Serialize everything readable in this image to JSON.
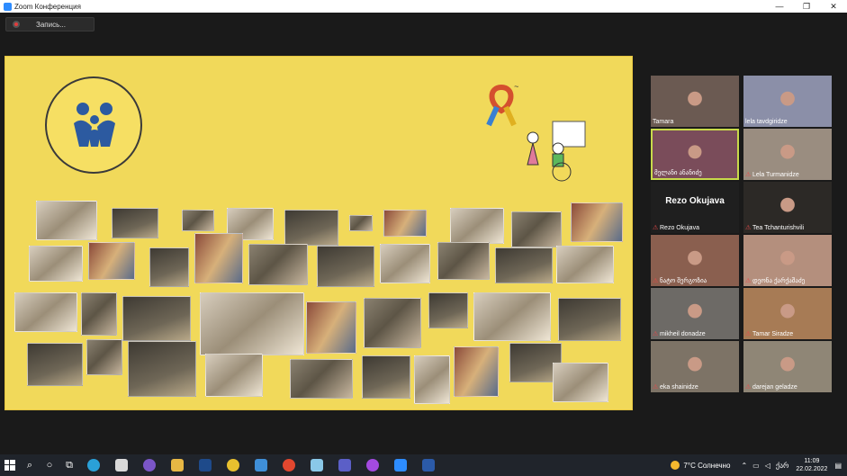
{
  "window": {
    "title": "Zoom Конференция",
    "min": "—",
    "max": "❐",
    "close": "✕"
  },
  "recording": {
    "label": "Запись..."
  },
  "gallery": {
    "tiles": [
      {
        "name": "Tamara",
        "muted": false,
        "color": "#6b5a52"
      },
      {
        "name": "lela tavdgiridze",
        "muted": false,
        "color": "#8b8fa8"
      },
      {
        "name": "მელანი ანანიძე",
        "muted": false,
        "color": "#7a4c5a",
        "active": true
      },
      {
        "name": "Lela Turmanidze",
        "muted": true,
        "color": "#9a8d80"
      },
      {
        "name": "Rezo Okujava",
        "muted": true,
        "color": "#1f1f1f",
        "avatar_text": "Rezo Okujava"
      },
      {
        "name": "Tea Tchanturishvili",
        "muted": true,
        "color": "#2c2926"
      },
      {
        "name": "ნატო შერგოზია",
        "muted": true,
        "color": "#8a5f4f"
      },
      {
        "name": "დეონა ქარქაშაძე",
        "muted": true,
        "color": "#b48f7d"
      },
      {
        "name": "mikheil donadze",
        "muted": true,
        "color": "#6d6a66"
      },
      {
        "name": "Tamar Siradze",
        "muted": true,
        "color": "#a77b55"
      },
      {
        "name": "eka shainidze",
        "muted": true,
        "color": "#7d7366"
      },
      {
        "name": "darejan geladze",
        "muted": true,
        "color": "#8f8676"
      }
    ]
  },
  "taskbar": {
    "weather": "7°C  Солнечно",
    "time": "11:09",
    "date": "22.02.2022",
    "lang": "ქარ",
    "apps": [
      {
        "name": "edge",
        "color": "#2aa0d8"
      },
      {
        "name": "store",
        "color": "#d9d9d9"
      },
      {
        "name": "viber",
        "color": "#7b56c8"
      },
      {
        "name": "explorer",
        "color": "#e7b744"
      },
      {
        "name": "b-app",
        "color": "#1e4a8a"
      },
      {
        "name": "chrome",
        "color": "#e8c02e"
      },
      {
        "name": "mail",
        "color": "#3f8fd8"
      },
      {
        "name": "media",
        "color": "#e2472f"
      },
      {
        "name": "paint",
        "color": "#8ac8e8"
      },
      {
        "name": "teams",
        "color": "#5b5fc7"
      },
      {
        "name": "messenger",
        "color": "#a34ae0"
      },
      {
        "name": "zoom",
        "color": "#2d8cff"
      },
      {
        "name": "word",
        "color": "#2b5aa8"
      }
    ]
  }
}
